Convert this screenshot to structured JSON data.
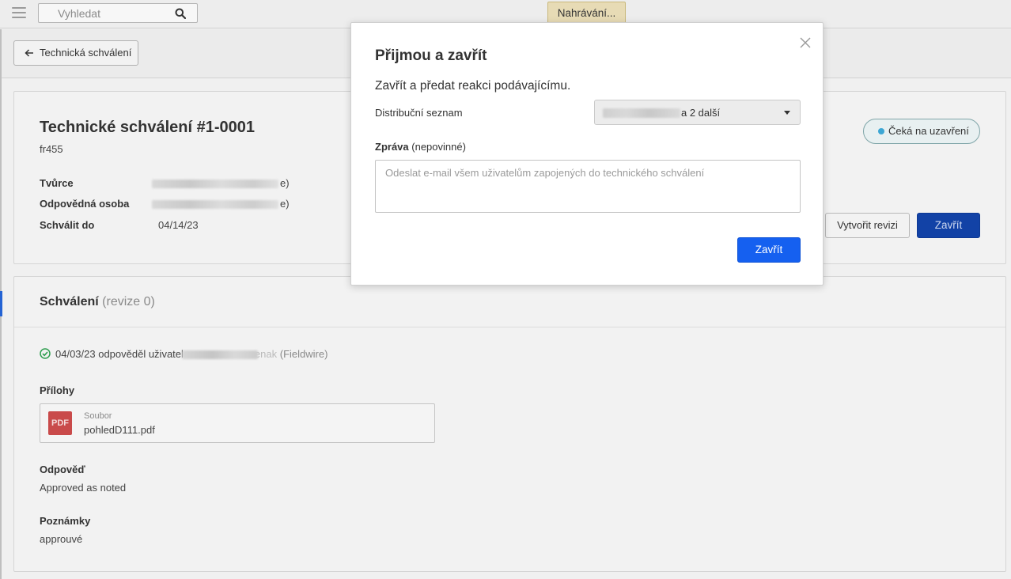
{
  "topbar": {
    "search_placeholder": "Vyhledat",
    "upload_status": "Nahrávání..."
  },
  "backbar": {
    "back_label": "Technická schválení"
  },
  "submittal": {
    "title": "Technické schválení #1-0001",
    "subtitle": "fr455",
    "creator_label": "Tvůrce",
    "creator_suffix": "e)",
    "responsible_label": "Odpovědná osoba",
    "responsible_suffix": "e)",
    "approve_by_label": "Schválit do",
    "approve_by_value": "04/14/23",
    "status": "Čeká na uzavření",
    "status_color": "#3ca6d4",
    "create_revision_label": "Vytvořit revizi",
    "close_label": "Zavřít"
  },
  "approval": {
    "title": "Schválení",
    "revision": "(revize 0)",
    "response_prefix": "04/03/23 odpověděl uživatel",
    "response_name_tail": "enak",
    "response_source": "(Fieldwire)",
    "attachments_label": "Přílohy",
    "attachment": {
      "icon_label": "PDF",
      "type": "Soubor",
      "name": "pohledD111.pdf"
    },
    "answer_label": "Odpověď",
    "answer_value": "Approved as noted",
    "notes_label": "Poznámky",
    "notes_value": "approuvé"
  },
  "modal": {
    "title": "Přijmou a zavřít",
    "subtitle": "Zavřít a předat reakci podávajícímu.",
    "distribution_label": "Distribuční seznam",
    "distribution_value": "a 2 další",
    "message_label_bold": "Zpráva",
    "message_label_rest": "(nepovinné)",
    "message_placeholder": "Odeslat e-mail všem uživatelům zapojených do technického schválení",
    "submit_label": "Zavřít"
  },
  "colors": {
    "primary": "#1560f0",
    "primary_dimmed": "#1242a6",
    "pdf": "#c94a4a",
    "success": "#2e9e4f"
  }
}
